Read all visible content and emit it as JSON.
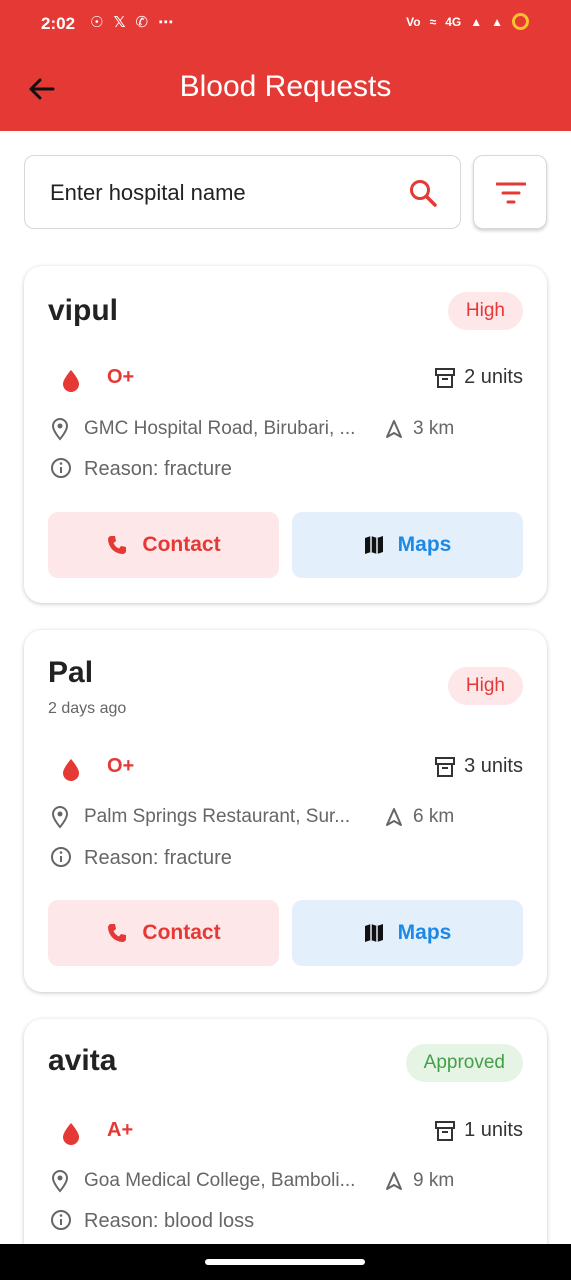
{
  "status_bar": {
    "time": "2:02",
    "left_icons": [
      "snapchat-icon",
      "x-icon",
      "whatsapp-icon",
      "hotspot-icon"
    ],
    "right_text": "4G"
  },
  "header": {
    "title": "Blood Requests"
  },
  "search": {
    "placeholder": "Enter hospital name"
  },
  "requests": [
    {
      "name": "vipul",
      "time_ago": "",
      "priority": "High",
      "blood_type": "O+",
      "units": "2 units",
      "address": "GMC Hospital Road, Birubari, ...",
      "distance": "3 km",
      "reason": "Reason: fracture",
      "contact_label": "Contact",
      "maps_label": "Maps"
    },
    {
      "name": "Pal",
      "time_ago": "2 days ago",
      "priority": "High",
      "blood_type": "O+",
      "units": "3 units",
      "address": "Palm Springs Restaurant, Sur...",
      "distance": "6 km",
      "reason": "Reason: fracture",
      "contact_label": "Contact",
      "maps_label": "Maps"
    },
    {
      "name": "avita",
      "time_ago": "",
      "priority": "Approved",
      "blood_type": "A+",
      "units": "1 units",
      "address": "Goa Medical College, Bamboli...",
      "distance": "9 km",
      "reason": "Reason: blood loss",
      "contact_label": "Contact",
      "maps_label": "Maps"
    }
  ],
  "colors": {
    "primary": "#e53935",
    "badge_high_bg": "#fde7e9",
    "approved": "#43a047",
    "maps_blue": "#1e88e5"
  }
}
